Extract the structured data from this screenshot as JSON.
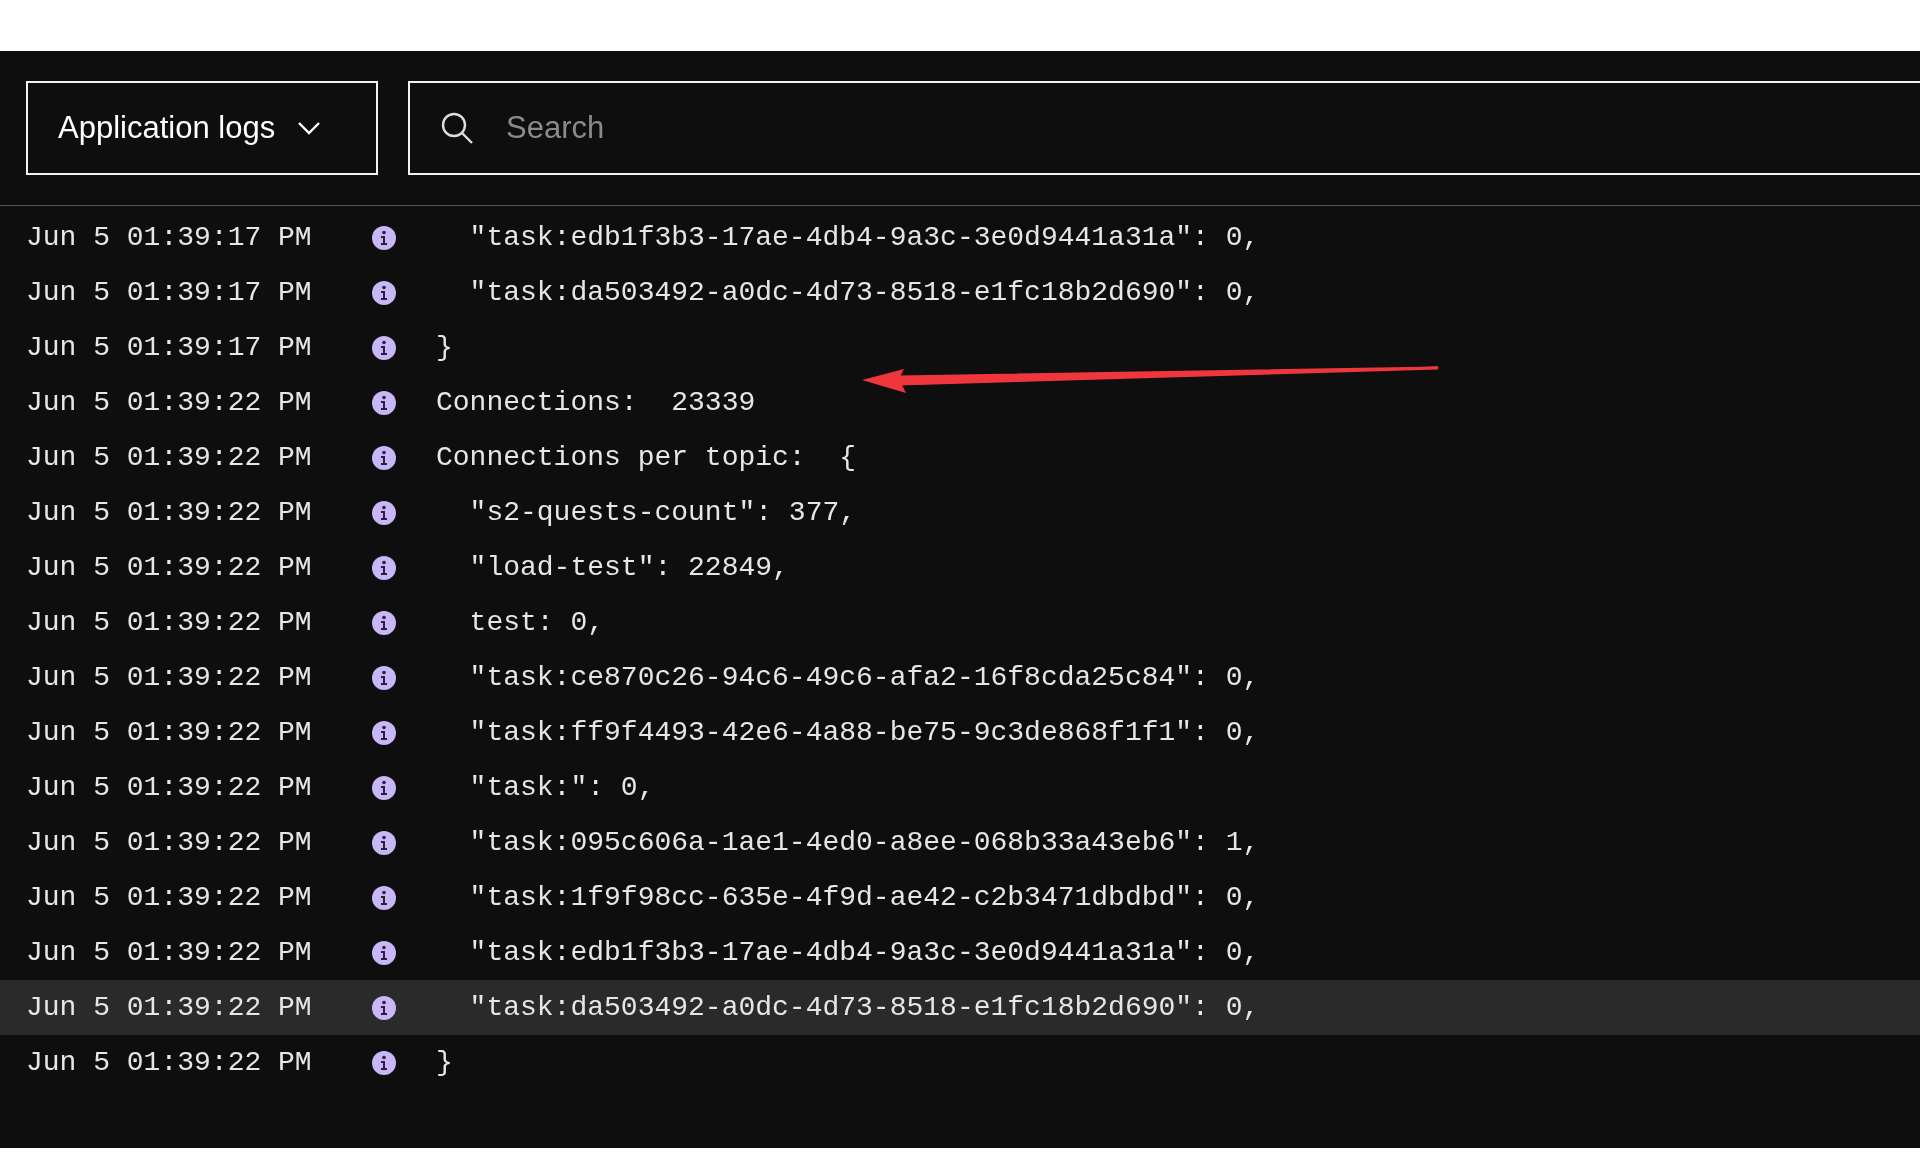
{
  "source_dropdown": {
    "label": "Application logs"
  },
  "search": {
    "placeholder": "Search"
  },
  "log_rows": [
    {
      "time": "Jun 5 01:39:17 PM",
      "kind": "info",
      "message": "  \"task:edb1f3b3-17ae-4db4-9a3c-3e0d9441a31a\": 0,",
      "selected": false
    },
    {
      "time": "Jun 5 01:39:17 PM",
      "kind": "info",
      "message": "  \"task:da503492-a0dc-4d73-8518-e1fc18b2d690\": 0,",
      "selected": false
    },
    {
      "time": "Jun 5 01:39:17 PM",
      "kind": "info",
      "message": "}",
      "selected": false
    },
    {
      "time": "Jun 5 01:39:22 PM",
      "kind": "info",
      "message": "Connections:  23339",
      "selected": false
    },
    {
      "time": "Jun 5 01:39:22 PM",
      "kind": "info",
      "message": "Connections per topic:  {",
      "selected": false
    },
    {
      "time": "Jun 5 01:39:22 PM",
      "kind": "info",
      "message": "  \"s2-quests-count\": 377,",
      "selected": false
    },
    {
      "time": "Jun 5 01:39:22 PM",
      "kind": "info",
      "message": "  \"load-test\": 22849,",
      "selected": false
    },
    {
      "time": "Jun 5 01:39:22 PM",
      "kind": "info",
      "message": "  test: 0,",
      "selected": false
    },
    {
      "time": "Jun 5 01:39:22 PM",
      "kind": "info",
      "message": "  \"task:ce870c26-94c6-49c6-afa2-16f8cda25c84\": 0,",
      "selected": false
    },
    {
      "time": "Jun 5 01:39:22 PM",
      "kind": "info",
      "message": "  \"task:ff9f4493-42e6-4a88-be75-9c3de868f1f1\": 0,",
      "selected": false
    },
    {
      "time": "Jun 5 01:39:22 PM",
      "kind": "info",
      "message": "  \"task:\": 0,",
      "selected": false
    },
    {
      "time": "Jun 5 01:39:22 PM",
      "kind": "info",
      "message": "  \"task:095c606a-1ae1-4ed0-a8ee-068b33a43eb6\": 1,",
      "selected": false
    },
    {
      "time": "Jun 5 01:39:22 PM",
      "kind": "info",
      "message": "  \"task:1f9f98cc-635e-4f9d-ae42-c2b3471dbdbd\": 0,",
      "selected": false
    },
    {
      "time": "Jun 5 01:39:22 PM",
      "kind": "info",
      "message": "  \"task:edb1f3b3-17ae-4db4-9a3c-3e0d9441a31a\": 0,",
      "selected": false
    },
    {
      "time": "Jun 5 01:39:22 PM",
      "kind": "info",
      "message": "  \"task:da503492-a0dc-4d73-8518-e1fc18b2d690\": 0,",
      "selected": true
    },
    {
      "time": "Jun 5 01:39:22 PM",
      "kind": "info",
      "message": "}",
      "selected": false
    }
  ]
}
